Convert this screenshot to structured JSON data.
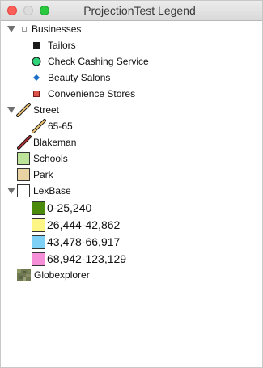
{
  "window": {
    "title": "ProjectionTest Legend"
  },
  "colors": {
    "tailors": "#1a1a1a",
    "check_cashing": "#2fd37a",
    "beauty_salons": "#1a6fc7",
    "convenience": "#d9534a",
    "street_line": "#e8c070",
    "blakeman_line": "#7a1a20",
    "schools": "#bde39a",
    "park": "#ead3a3",
    "lexbase": "#ffffff",
    "range1": "#4b8a0a",
    "range2": "#fdf685",
    "range3": "#7fd0f6",
    "range4": "#f590d8"
  },
  "legend": {
    "businesses": {
      "label": "Businesses",
      "items": [
        {
          "label": "Tailors",
          "icon": "square-marker"
        },
        {
          "label": "Check Cashing Service",
          "icon": "circle-marker"
        },
        {
          "label": "Beauty Salons",
          "icon": "diamond-marker"
        },
        {
          "label": "Convenience Stores",
          "icon": "square-marker"
        }
      ]
    },
    "street": {
      "label": "Street",
      "items": [
        {
          "label": "65-65"
        }
      ]
    },
    "blakeman": {
      "label": "Blakeman"
    },
    "schools": {
      "label": "Schools"
    },
    "park": {
      "label": "Park"
    },
    "lexbase": {
      "label": "LexBase",
      "items": [
        {
          "label": "0-25,240"
        },
        {
          "label": "26,444-42,862"
        },
        {
          "label": "43,478-66,917"
        },
        {
          "label": "68,942-123,129"
        }
      ]
    },
    "globexplorer": {
      "label": "Globexplorer",
      "icon": "raster-image-icon"
    }
  }
}
